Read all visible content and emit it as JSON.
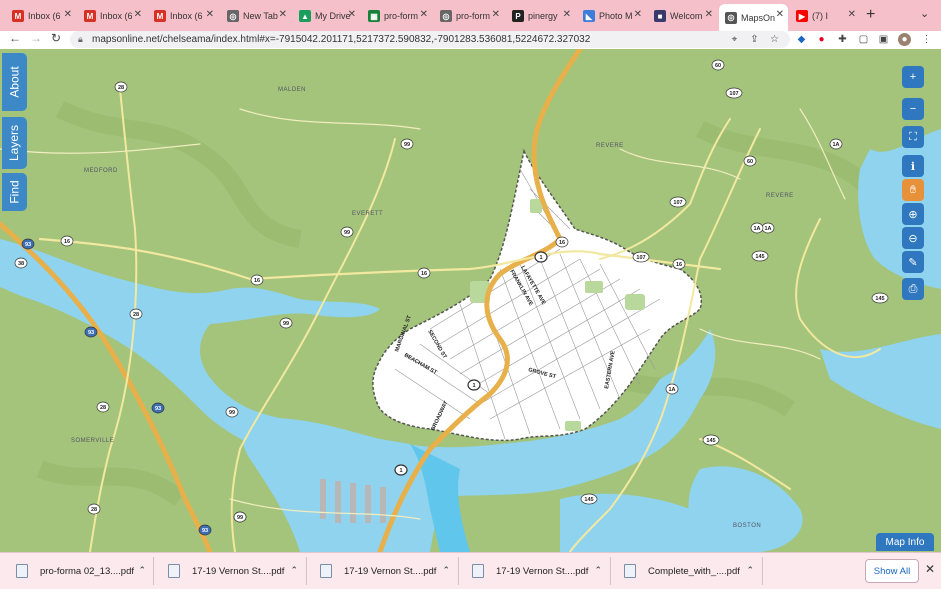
{
  "tabs": [
    {
      "label": "Inbox (6",
      "icon": "gmail-icon",
      "color": "#d93025",
      "glyph": "M"
    },
    {
      "label": "Inbox (6",
      "icon": "gmail-icon",
      "color": "#d93025",
      "glyph": "M"
    },
    {
      "label": "Inbox (6",
      "icon": "gmail-icon",
      "color": "#d93025",
      "glyph": "M"
    },
    {
      "label": "New Tab",
      "icon": "chrome-icon",
      "color": "#666666",
      "glyph": "◎"
    },
    {
      "label": "My Drive",
      "icon": "drive-icon",
      "color": "#1a9e5c",
      "glyph": "▲"
    },
    {
      "label": "pro-form",
      "icon": "sheets-icon",
      "color": "#188038",
      "glyph": "▦"
    },
    {
      "label": "pro-form",
      "icon": "globe-icon",
      "color": "#666666",
      "glyph": "◎"
    },
    {
      "label": "pinergy",
      "icon": "pinergy-icon",
      "color": "#222222",
      "glyph": "P"
    },
    {
      "label": "Photo M",
      "icon": "photo-icon",
      "color": "#3b7dd8",
      "glyph": "◣"
    },
    {
      "label": "Welcom",
      "icon": "window-icon",
      "color": "#3a3a6a",
      "glyph": "■"
    },
    {
      "label": "MapsOn",
      "icon": "globe-icon",
      "color": "#555555",
      "glyph": "◎",
      "active": true
    },
    {
      "label": "(7) I",
      "icon": "youtube-icon",
      "color": "#ff0000",
      "glyph": "▶"
    }
  ],
  "toolbar": {
    "url": "mapsonline.net/chelseama/index.html#x=-7915042.201171,5217372.590832,-7901283.536081,5224672.327032"
  },
  "map": {
    "side_tabs": [
      "About",
      "Layers",
      "Find"
    ],
    "map_info": "Map Info",
    "places": [
      "MALDEN",
      "MEDFORD",
      "EVERETT",
      "REVERE",
      "SOMERVILLE",
      "BOSTON"
    ],
    "street_labels": [
      "LAFAYETTE AVE",
      "FRANKLIN AVE",
      "MARGINAL ST",
      "SECOND ST",
      "BEACHAM ST",
      "GROVE ST",
      "EASTERN AVE",
      "BROADWAY"
    ],
    "route_shields": [
      "1",
      "1",
      "1",
      "1A",
      "1A",
      "1A",
      "1A",
      "16",
      "16",
      "16",
      "16",
      "16",
      "28",
      "28",
      "28",
      "28",
      "38",
      "60",
      "60",
      "93",
      "93",
      "93",
      "93",
      "99",
      "99",
      "99",
      "99",
      "99",
      "99",
      "107",
      "107",
      "107",
      "145",
      "145",
      "145",
      "145"
    ],
    "colors": {
      "land": "#a3c47a",
      "water": "#8fd3ef",
      "city": "#ffffff",
      "highway": "#e8b04a"
    }
  },
  "downloads": [
    "pro-forma 02_13....pdf",
    "17-19 Vernon St....pdf",
    "17-19 Vernon St....pdf",
    "17-19 Vernon St....pdf",
    "Complete_with_....pdf"
  ],
  "show_all": "Show All"
}
